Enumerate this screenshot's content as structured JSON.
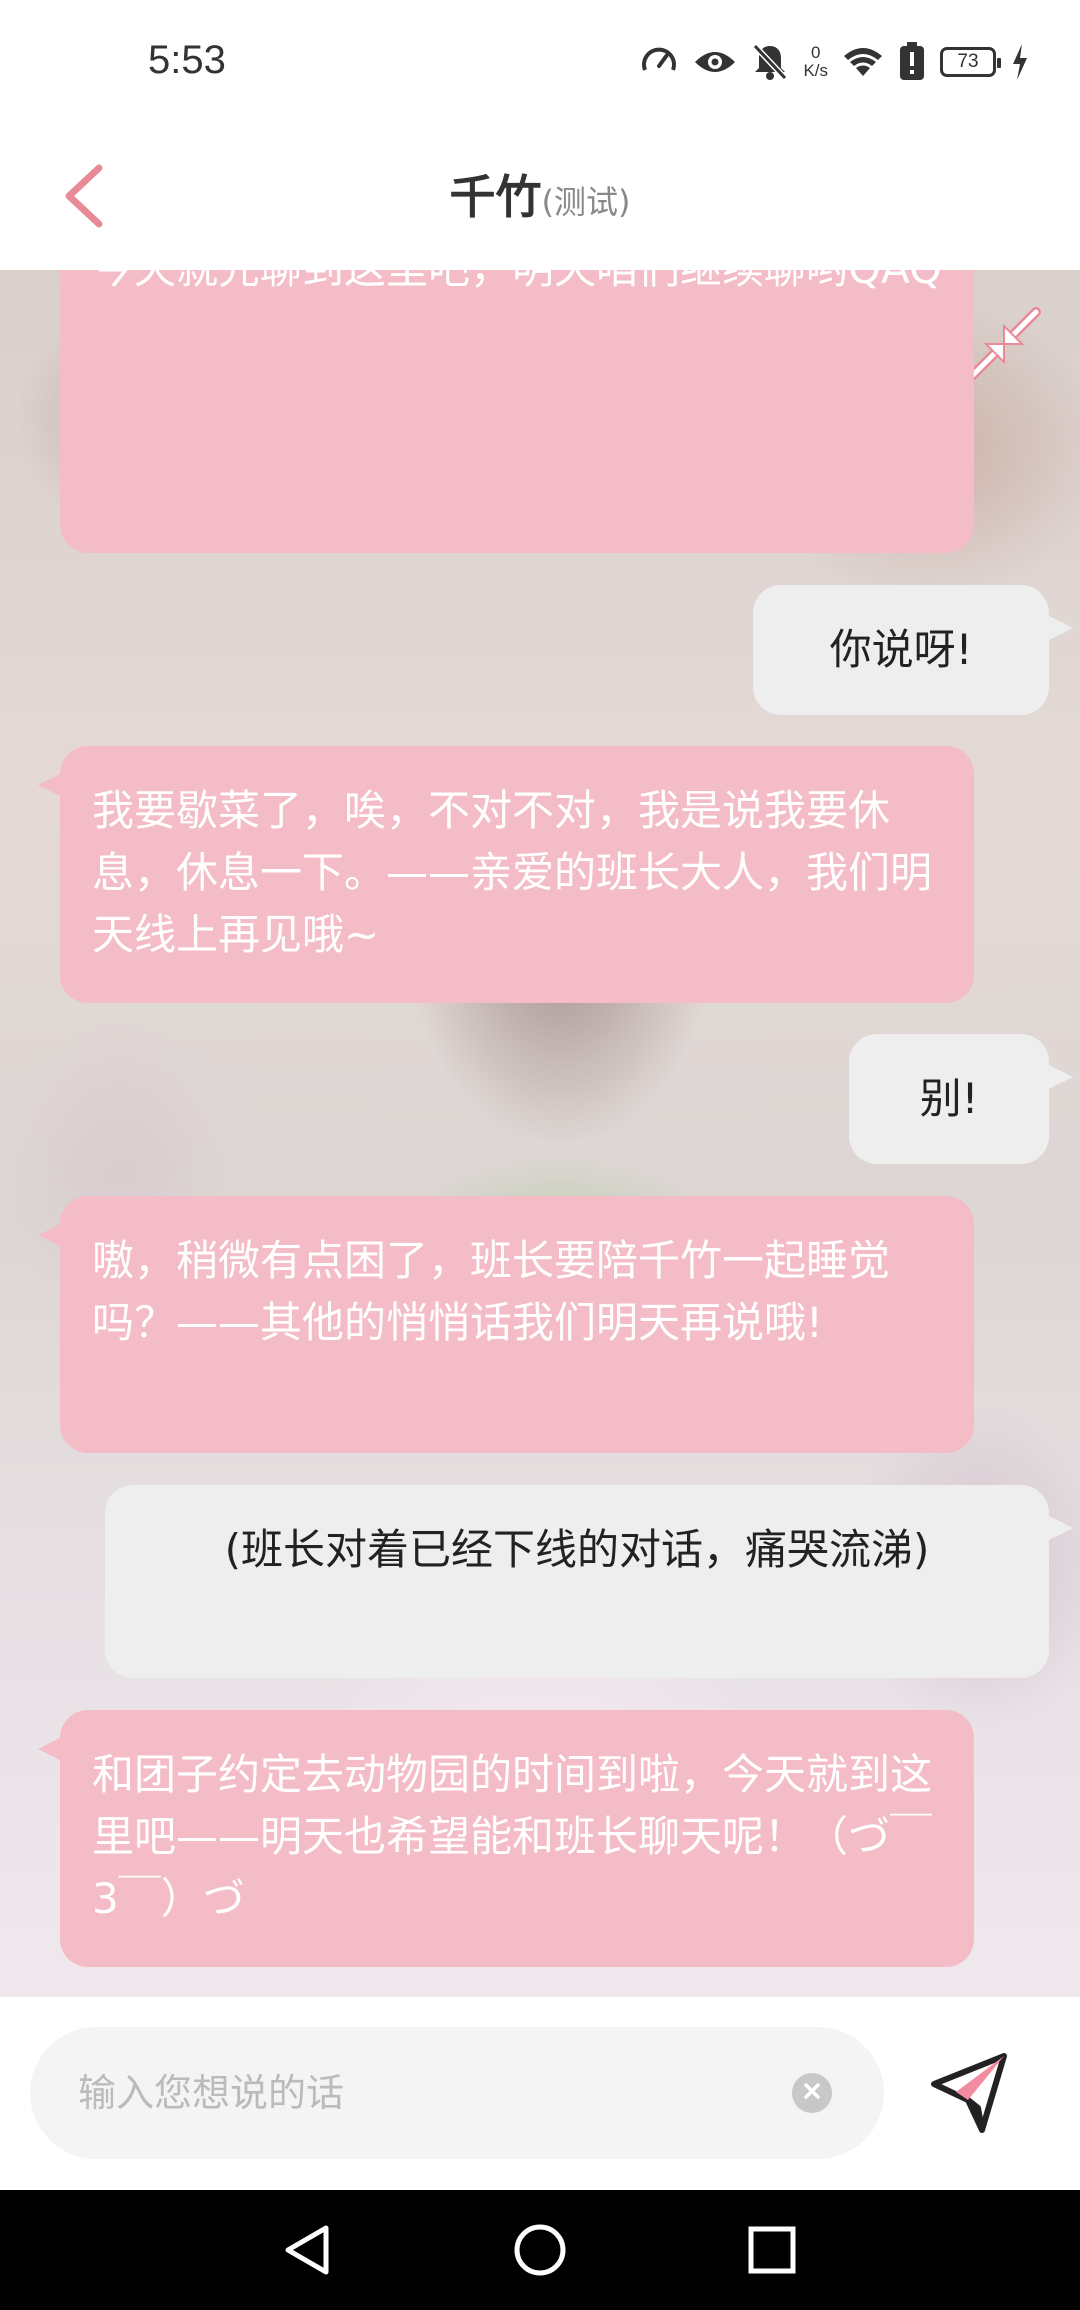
{
  "status_bar": {
    "time": "5:53",
    "net_speed_value": "0",
    "net_speed_unit": "K/s",
    "battery_level": "73",
    "icons": [
      "speedometer-icon",
      "eye-icon",
      "bell-off-icon",
      "wifi-icon",
      "battery-alert-icon",
      "battery-icon",
      "charging-icon"
    ]
  },
  "header": {
    "back_icon": "chevron-left-icon",
    "title": "千竹",
    "subtitle": "(测试)"
  },
  "chat": {
    "collapse_icon": "collapse-arrows-icon",
    "messages": [
      {
        "side": "left",
        "text": "今天就先聊到这里吧，明天咱们继续聊哟QAQ"
      },
      {
        "side": "right",
        "text": "你说呀!"
      },
      {
        "side": "left",
        "text": "我要歇菜了，唉，不对不对，我是说我要休息，休息一下。——亲爱的班长大人，我们明天线上再见哦~"
      },
      {
        "side": "right",
        "text": "别!"
      },
      {
        "side": "left",
        "text": "嗷，稍微有点困了，班长要陪千竹一起睡觉吗？——其他的悄悄话我们明天再说哦!"
      },
      {
        "side": "right",
        "text": "(班长对着已经下线的对话，痛哭流涕)"
      },
      {
        "side": "left",
        "text": "和团子约定去动物园的时间到啦，今天就到这里吧——明天也希望能和班长聊天呢！（づ￣3￣）づ"
      }
    ]
  },
  "input": {
    "placeholder": "输入您想说的话",
    "value": "",
    "clear_icon": "clear-icon",
    "send_icon": "send-plane-icon"
  },
  "nav_bar": {
    "icons": [
      "back-triangle-icon",
      "home-circle-icon",
      "recents-square-icon"
    ]
  },
  "colors": {
    "accent": "#e98a98",
    "bubble_left": "#f3bcc6",
    "bubble_right": "#eeeeee"
  }
}
